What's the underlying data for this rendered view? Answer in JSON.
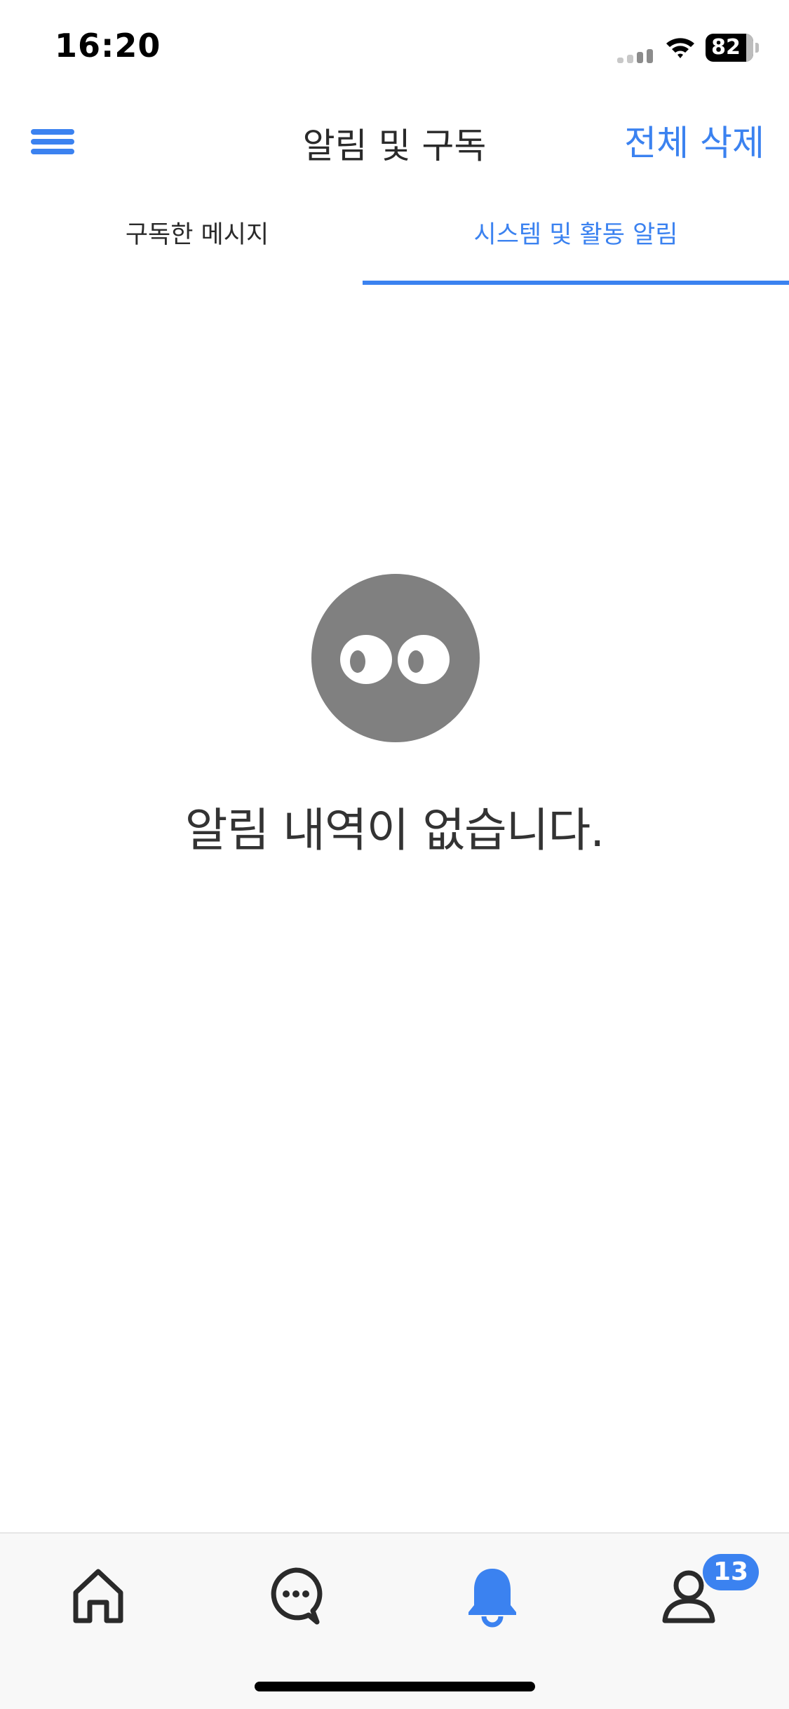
{
  "status_bar": {
    "time": "16:20",
    "battery": "82",
    "icons": [
      "signal-icon",
      "wifi-icon",
      "battery-icon"
    ]
  },
  "header": {
    "title": "알림 및 구독",
    "delete_all_label": "전체 삭제",
    "menu_icon": "menu-icon"
  },
  "tabs": [
    {
      "label": "구독한 메시지",
      "active": false
    },
    {
      "label": "시스템 및 활동 알림",
      "active": true
    }
  ],
  "empty_state": {
    "icon": "eyes-face-icon",
    "message": "알림 내역이 없습니다."
  },
  "bottom_nav": {
    "items": [
      {
        "icon": "home-icon",
        "active": false
      },
      {
        "icon": "chat-icon",
        "active": false
      },
      {
        "icon": "bell-icon",
        "active": true
      },
      {
        "icon": "profile-icon",
        "active": false,
        "badge": "13"
      }
    ]
  },
  "colors": {
    "accent": "#3b82f0",
    "text": "#2a2a2a",
    "empty_icon": "#808080",
    "nav_background": "#f8f8f8"
  }
}
